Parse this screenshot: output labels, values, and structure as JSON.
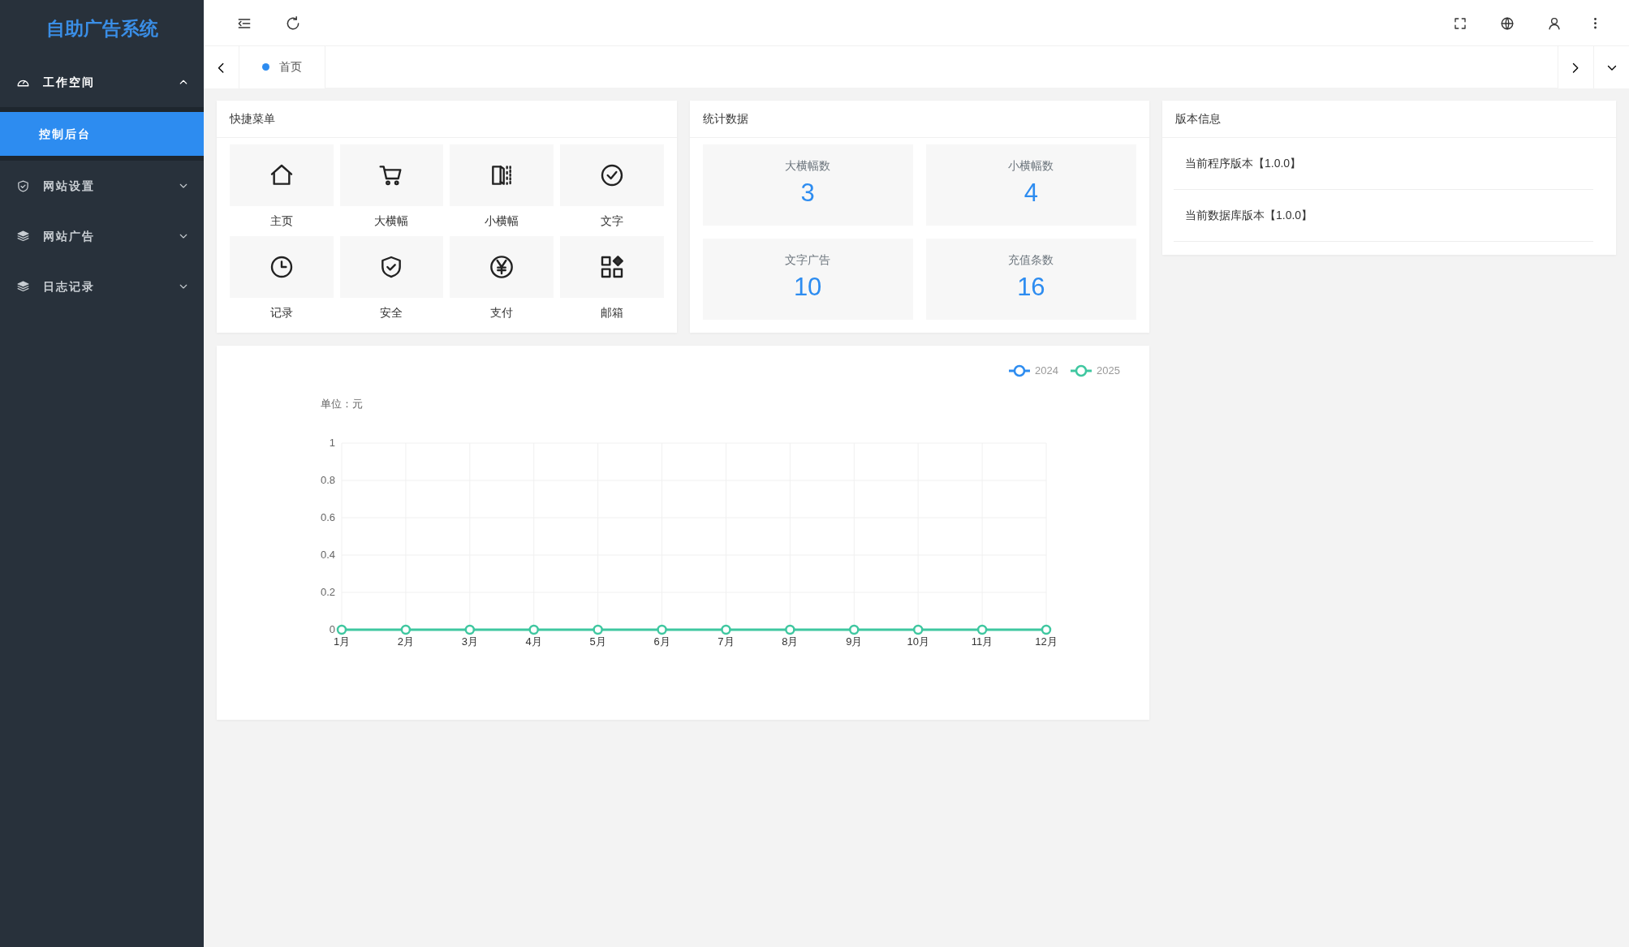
{
  "sidebar": {
    "title": "自助广告系统",
    "items": [
      {
        "label": "工作空间",
        "expanded": true,
        "children": [
          {
            "label": "控制后台",
            "selected": true
          }
        ]
      },
      {
        "label": "网站设置",
        "expanded": false
      },
      {
        "label": "网站广告",
        "expanded": false
      },
      {
        "label": "日志记录",
        "expanded": false
      }
    ]
  },
  "tabs": [
    {
      "label": "首页",
      "selected": true
    }
  ],
  "quick_menu": {
    "title": "快捷菜单",
    "items": [
      {
        "label": "主页"
      },
      {
        "label": "大横幅"
      },
      {
        "label": "小横幅"
      },
      {
        "label": "文字"
      },
      {
        "label": "记录"
      },
      {
        "label": "安全"
      },
      {
        "label": "支付"
      },
      {
        "label": "邮箱"
      }
    ]
  },
  "stats": {
    "title": "统计数据",
    "items": [
      {
        "label": "大横幅数",
        "value": "3"
      },
      {
        "label": "小横幅数",
        "value": "4"
      },
      {
        "label": "文字广告",
        "value": "10"
      },
      {
        "label": "充值条数",
        "value": "16"
      }
    ]
  },
  "version_info": {
    "title": "版本信息",
    "items": [
      "当前程序版本【1.0.0】",
      "当前数据库版本【1.0.0】"
    ]
  },
  "chart": {
    "chart_data": {
      "type": "line",
      "ylabel": "单位：元",
      "categories": [
        "1月",
        "2月",
        "3月",
        "4月",
        "5月",
        "6月",
        "7月",
        "8月",
        "9月",
        "10月",
        "11月",
        "12月"
      ],
      "ylim": [
        0,
        1
      ],
      "yticks": [
        0,
        0.2,
        0.4,
        0.6,
        0.8,
        1
      ],
      "grid": true,
      "legend": true,
      "series": [
        {
          "name": "2024",
          "color": "#2d8cf0",
          "marker": "circle",
          "values": [
            null,
            null,
            null,
            null,
            null,
            null,
            null,
            null,
            null,
            null,
            null,
            null
          ]
        },
        {
          "name": "2025",
          "color": "#3fc7a0",
          "marker": "circle",
          "values": [
            0,
            0,
            0,
            0,
            0,
            0,
            0,
            0,
            0,
            0,
            0,
            0
          ]
        }
      ]
    }
  }
}
